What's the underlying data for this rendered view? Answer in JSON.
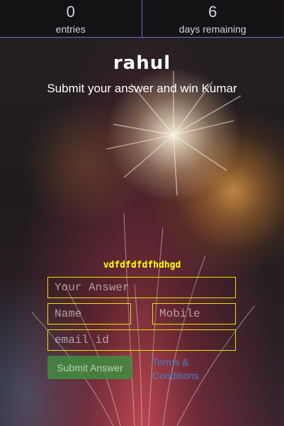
{
  "stats": {
    "entries": {
      "value": "0",
      "label": "entries"
    },
    "days": {
      "value": "6",
      "label": "days remaining"
    }
  },
  "header": {
    "title": "rahul",
    "subtitle": "Submit your answer and win Kumar"
  },
  "question": "vdfdfdfdfhdhgd",
  "form": {
    "answer_placeholder": "Your Answer",
    "name_placeholder": "Name",
    "mobile_placeholder": "Mobile",
    "email_placeholder": "email id",
    "submit_label": "Submit Answer",
    "terms_link": "Terms & Conditions"
  },
  "colors": {
    "field_border": "#e6e600",
    "question_text": "#ffff00",
    "submit_bg": "#3f8e3f",
    "divider": "#6b6fd3",
    "link": "#4a7ec6"
  },
  "background": {
    "icon": "fireworks-background"
  }
}
